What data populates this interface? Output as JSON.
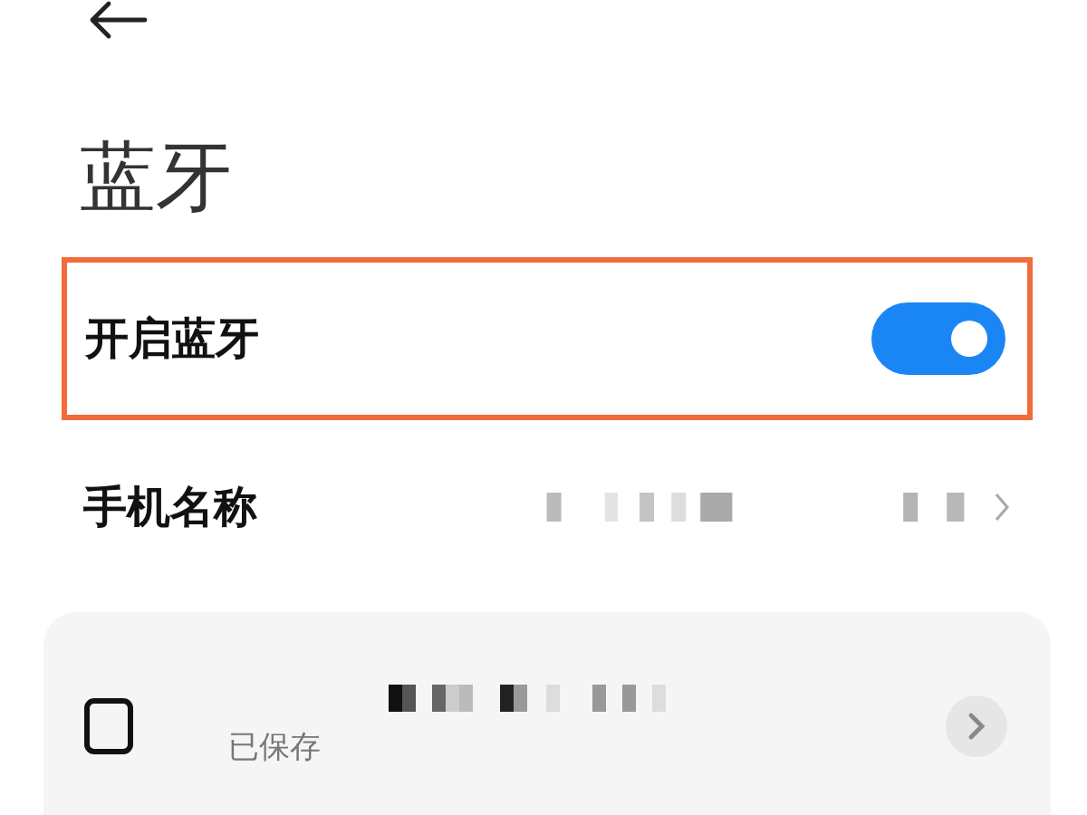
{
  "header": {
    "title": "蓝牙"
  },
  "bluetooth_toggle": {
    "label": "开启蓝牙",
    "on": true,
    "highlighted": true
  },
  "phone_name": {
    "label": "手机名称"
  },
  "devices": [
    {
      "status": "已保存"
    }
  ]
}
